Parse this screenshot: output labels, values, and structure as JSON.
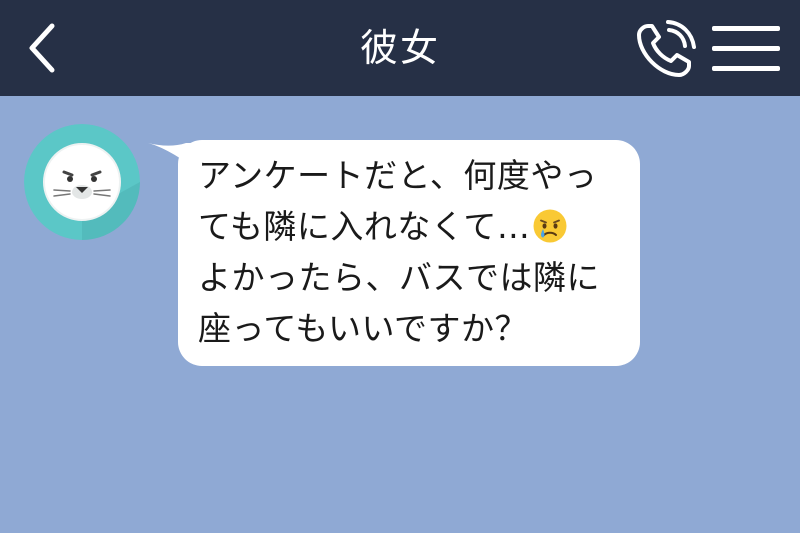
{
  "header": {
    "title": "彼女",
    "back_icon": "chevron-left-icon",
    "call_icon": "phone-icon",
    "menu_icon": "hamburger-menu-icon"
  },
  "chat": {
    "message": {
      "sender_avatar": "seal-avatar",
      "lines": [
        "アンケートだと、何度やっ",
        "ても隣に入れなくて…",
        "よかったら、バスでは隣に",
        "座ってもいいですか？"
      ],
      "emoji": "crying-face-emoji"
    }
  },
  "colors": {
    "header_bg": "#263046",
    "chat_bg": "#8fa9d4",
    "bubble_bg": "#ffffff",
    "avatar_bg": "#5bc7c7"
  }
}
